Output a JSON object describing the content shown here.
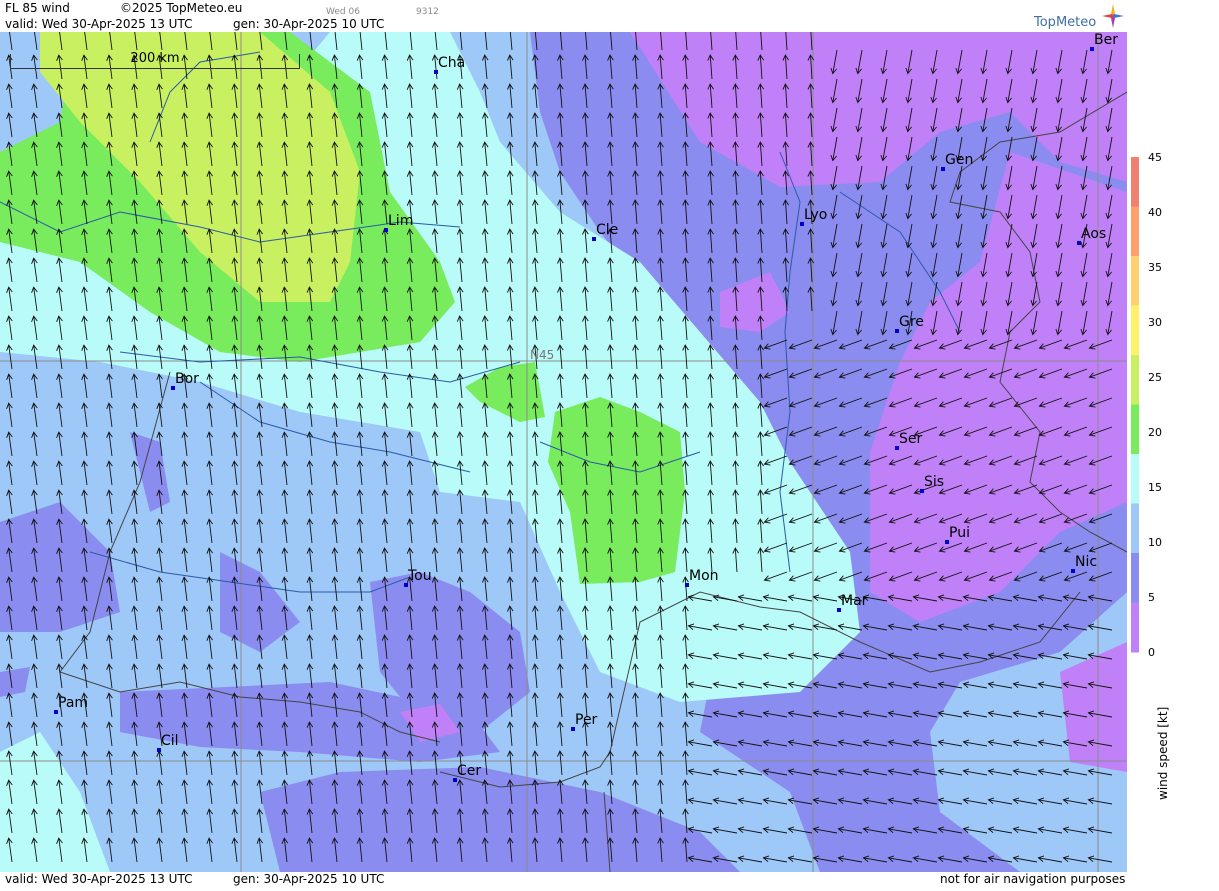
{
  "header": {
    "product": "FL 85 wind",
    "copyright": "©2025 TopMeteo.eu",
    "day_code": "Wed 06",
    "code": "9312",
    "valid": "valid:  Wed  30-Apr-2025  13 UTC",
    "gen": "gen: 30-Apr-2025 10 UTC",
    "logo_text": "TopMeteo"
  },
  "footer": {
    "valid": "valid:  Wed  30-Apr-2025  13 UTC",
    "gen": "gen: 30-Apr-2025 10 UTC",
    "disclaimer": "not for air navigation purposes"
  },
  "map": {
    "scale_label": "200 km",
    "latitude_label": "N45",
    "cities": [
      {
        "name": "Cha"
      },
      {
        "name": "Ber"
      },
      {
        "name": "Gen"
      },
      {
        "name": "Lim"
      },
      {
        "name": "Cle"
      },
      {
        "name": "Lyo"
      },
      {
        "name": "Aos"
      },
      {
        "name": "Gre"
      },
      {
        "name": "Bor"
      },
      {
        "name": "Ser"
      },
      {
        "name": "Sis"
      },
      {
        "name": "Pui"
      },
      {
        "name": "Nic"
      },
      {
        "name": "Tou"
      },
      {
        "name": "Mon"
      },
      {
        "name": "Mar"
      },
      {
        "name": "Pam"
      },
      {
        "name": "Per"
      },
      {
        "name": "Cil"
      },
      {
        "name": "Cer"
      }
    ]
  },
  "legend": {
    "title": "wind speed [kt]",
    "ticks": [
      "45",
      "40",
      "35",
      "30",
      "25",
      "20",
      "15",
      "10",
      "5",
      "0"
    ],
    "colors": [
      "#f08070",
      "#ff9f6a",
      "#ffd070",
      "#fff26a",
      "#c8f060",
      "#78ec5c",
      "#b8fbf8",
      "#9ec8f8",
      "#8a8cf0",
      "#c080f8"
    ]
  }
}
